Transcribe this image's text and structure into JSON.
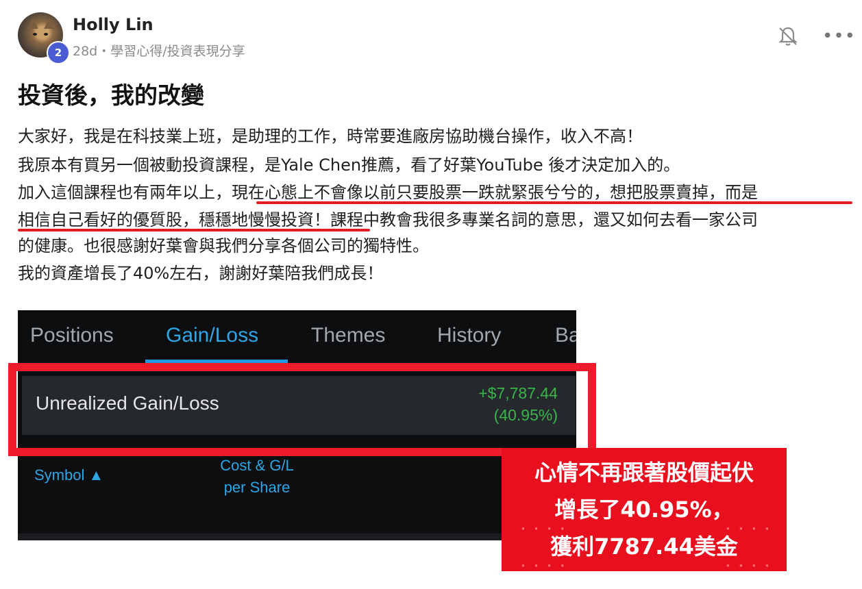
{
  "post": {
    "author": "Holly Lin",
    "level_badge": "2",
    "meta": "28d・學習心得/投資表現分享",
    "title": "投資後，我的改變",
    "paragraph_lines": [
      "大家好，我是在科技業上班，是助理的工作，時常要進廠房協助機台操作，收入不高！",
      "我原本有買另一個被動投資課程，是Yale Chen推薦，看了好葉YouTube 後才決定加入的。",
      "加入這個課程也有兩年以上，現在心態上不會像以前只要股票一跌就緊張兮兮的，想把股票賣掉，而是",
      "相信自己看好的優質股，穩穩地慢慢投資！課程中教會我很多專業名詞的意思，還又如何去看一家公司",
      "的健康。也很感謝好葉會與我們分享各個公司的獨特性。",
      "我的資產增長了40%左右，謝謝好葉陪我們成長！"
    ]
  },
  "icons": {
    "notify": "bell-off-icon",
    "more": "more-dots-icon",
    "more_glyph": "•••"
  },
  "screenshot": {
    "tabs": [
      "Positions",
      "Gain/Loss",
      "Themes",
      "History",
      "Ba"
    ],
    "active_tab": "Gain/Loss",
    "summary_label": "Unrealized Gain/Loss",
    "summary_value": "+$7,787.44",
    "summary_percent": "(40.95%)",
    "col_symbol": "Symbol ▲",
    "col_cost_line1": "Cost & G/L",
    "col_cost_line2": "per Share",
    "accent_color": "#2ea6e6",
    "gain_color": "#3ab54a"
  },
  "callout": {
    "line1": "心情不再跟著股價起伏",
    "line2": "增長了40.95%，",
    "line3": "獲利7787.44美金",
    "color": "#e8101e"
  }
}
